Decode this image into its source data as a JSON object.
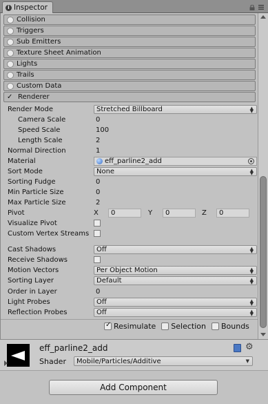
{
  "window": {
    "tab_title": "Inspector",
    "tab_icon": "info-icon"
  },
  "modules": [
    {
      "label": "Collision",
      "enabled": false
    },
    {
      "label": "Triggers",
      "enabled": false
    },
    {
      "label": "Sub Emitters",
      "enabled": false
    },
    {
      "label": "Texture Sheet Animation",
      "enabled": false
    },
    {
      "label": "Lights",
      "enabled": false
    },
    {
      "label": "Trails",
      "enabled": false
    },
    {
      "label": "Custom Data",
      "enabled": false
    },
    {
      "label": "Renderer",
      "enabled": true,
      "check_glyph": "✓"
    }
  ],
  "renderer": {
    "render_mode": {
      "label": "Render Mode",
      "value": "Stretched Billboard"
    },
    "camera_scale": {
      "label": "Camera Scale",
      "value": "0"
    },
    "speed_scale": {
      "label": "Speed Scale",
      "value": "100"
    },
    "length_scale": {
      "label": "Length Scale",
      "value": "2"
    },
    "normal_direction": {
      "label": "Normal Direction",
      "value": "1"
    },
    "material": {
      "label": "Material",
      "value": "eff_parline2_add"
    },
    "sort_mode": {
      "label": "Sort Mode",
      "value": "None"
    },
    "sorting_fudge": {
      "label": "Sorting Fudge",
      "value": "0"
    },
    "min_particle_size": {
      "label": "Min Particle Size",
      "value": "0"
    },
    "max_particle_size": {
      "label": "Max Particle Size",
      "value": "2"
    },
    "pivot": {
      "label": "Pivot",
      "x_label": "X",
      "x": "0",
      "y_label": "Y",
      "y": "0",
      "z_label": "Z",
      "z": "0"
    },
    "visualize_pivot": {
      "label": "Visualize Pivot",
      "checked": false
    },
    "custom_vertex_streams": {
      "label": "Custom Vertex Streams",
      "checked": false
    },
    "cast_shadows": {
      "label": "Cast Shadows",
      "value": "Off"
    },
    "receive_shadows": {
      "label": "Receive Shadows",
      "checked": false
    },
    "motion_vectors": {
      "label": "Motion Vectors",
      "value": "Per Object Motion"
    },
    "sorting_layer": {
      "label": "Sorting Layer",
      "value": "Default"
    },
    "order_in_layer": {
      "label": "Order in Layer",
      "value": "0"
    },
    "light_probes": {
      "label": "Light Probes",
      "value": "Off"
    },
    "reflection_probes": {
      "label": "Reflection Probes",
      "value": "Off"
    }
  },
  "preview_toggles": {
    "resimulate": {
      "label": "Resimulate",
      "checked": true
    },
    "selection": {
      "label": "Selection",
      "checked": false
    },
    "bounds": {
      "label": "Bounds",
      "checked": false
    }
  },
  "material_panel": {
    "name": "eff_parline2_add",
    "shader_label": "Shader",
    "shader_value": "Mobile/Particles/Additive"
  },
  "footer": {
    "add_component_label": "Add Component"
  },
  "colors": {
    "panel_bg": "#c2c2c2",
    "module_header": "#b7b7b7",
    "tab_bar": "#8f8f8f"
  }
}
